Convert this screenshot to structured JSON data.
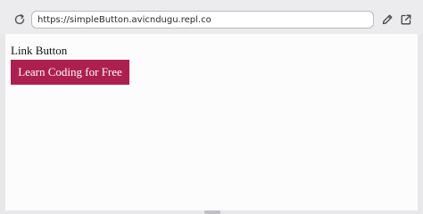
{
  "browser": {
    "url": "https://simpleButton.avicndugu.repl.co"
  },
  "page": {
    "heading": "Link Button",
    "button_label": "Learn Coding for Free"
  },
  "icons": {
    "reload": "reload-icon",
    "edit": "pencil-icon",
    "open_external": "open-in-new-tab-icon"
  },
  "colors": {
    "button_bg": "#ad1f4f",
    "button_text": "#ffffff"
  }
}
